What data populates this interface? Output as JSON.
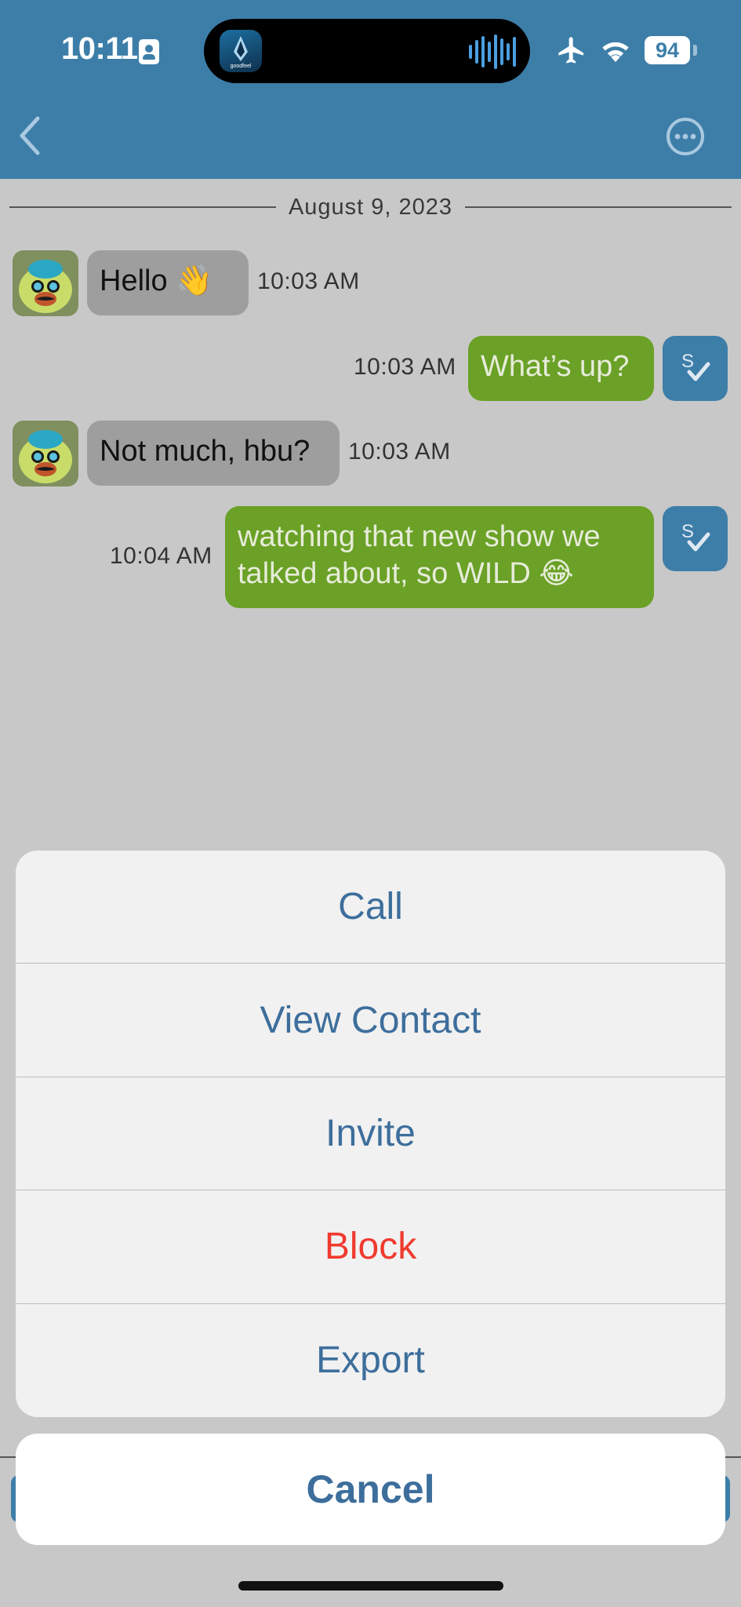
{
  "status_bar": {
    "time": "10:11",
    "battery": "94",
    "island_app_label": "goodfeel"
  },
  "header": {
    "back_icon": "chevron-left-icon",
    "more_icon": "ellipsis-circle-icon"
  },
  "chat": {
    "date": "August 9, 2023",
    "messages": [
      {
        "direction": "incoming",
        "text": "Hello 👋",
        "time": "10:03 AM"
      },
      {
        "direction": "outgoing",
        "text": "What’s up?",
        "time": "10:03 AM",
        "status_icon": "sent-check-icon"
      },
      {
        "direction": "incoming",
        "text": "Not much, hbu?",
        "time": "10:03 AM"
      },
      {
        "direction": "outgoing",
        "text": "watching that new show we talked about, so WILD 😂",
        "time": "10:04 AM",
        "status_icon": "sent-check-icon"
      }
    ]
  },
  "action_sheet": {
    "items": [
      {
        "label": "Call",
        "style": "default"
      },
      {
        "label": "View Contact",
        "style": "default"
      },
      {
        "label": "Invite",
        "style": "default"
      },
      {
        "label": "Block",
        "style": "destructive"
      },
      {
        "label": "Export",
        "style": "default"
      }
    ],
    "cancel_label": "Cancel"
  },
  "colors": {
    "header_bg": "#3d7ea9",
    "incoming_bubble": "#9e9e9e",
    "outgoing_bubble": "#6aa126",
    "sheet_text": "#3d6e9c",
    "destructive": "#f03a2e",
    "chat_bg": "#c8c8c8"
  }
}
